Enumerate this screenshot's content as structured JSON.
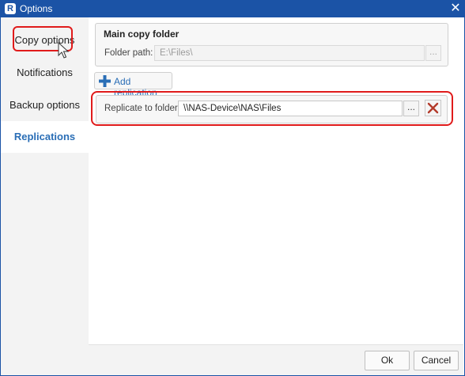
{
  "window": {
    "title": "Options"
  },
  "sidebar": {
    "items": [
      {
        "label": "Copy options"
      },
      {
        "label": "Notifications"
      },
      {
        "label": "Backup options"
      },
      {
        "label": "Replications"
      }
    ]
  },
  "main_copy_folder": {
    "title": "Main copy folder",
    "path_label": "Folder path:",
    "path_value": "E:\\Files\\",
    "browse_label": "..."
  },
  "add_replication": {
    "label": "Add replication"
  },
  "replication": {
    "label": "Replicate to folder:",
    "value": "\\\\NAS-Device\\NAS\\Files",
    "browse_label": "..."
  },
  "footer": {
    "ok_label": "Ok",
    "cancel_label": "Cancel"
  },
  "colors": {
    "title_bar": "#1b53a6",
    "accent": "#2a6eb6",
    "highlight": "#e01b1b"
  }
}
